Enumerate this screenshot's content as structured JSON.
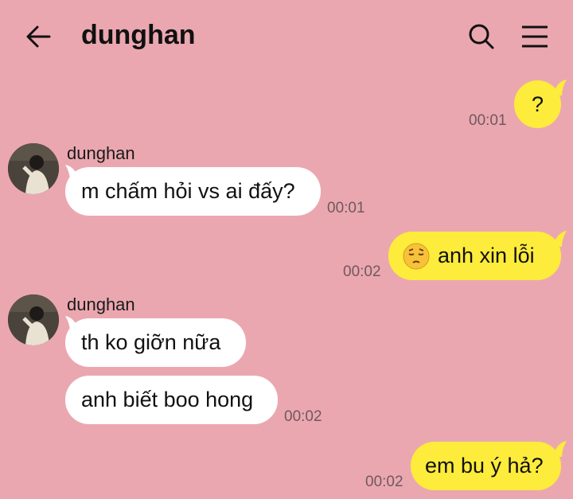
{
  "header": {
    "title": "dunghan"
  },
  "messages": [
    {
      "direction": "out",
      "text": "?",
      "time": "00:01"
    },
    {
      "direction": "in",
      "sender": "dunghan",
      "text": "m chấm hỏi vs ai đấy?",
      "time": "00:01"
    },
    {
      "direction": "out",
      "emoji": "pensive-face",
      "text": "anh xin lỗi",
      "time": "00:02"
    },
    {
      "direction": "in",
      "sender": "dunghan",
      "text": "th ko giỡn nữa"
    },
    {
      "direction": "in",
      "text": "anh biết boo hong",
      "time": "00:02"
    },
    {
      "direction": "out",
      "text": "em bu ý hả?",
      "time": "00:02"
    }
  ],
  "colors": {
    "background": "#eba7b0",
    "outgoing_bubble": "#fdec3b",
    "incoming_bubble": "#ffffff"
  }
}
